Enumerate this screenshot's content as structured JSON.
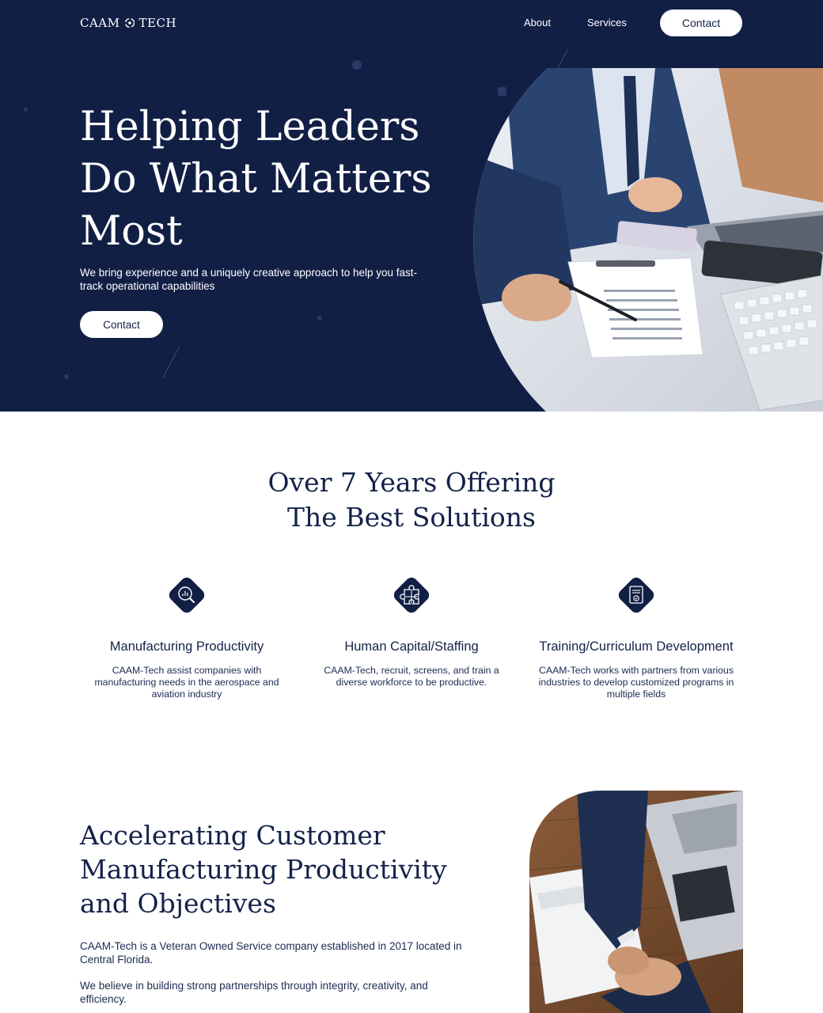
{
  "nav": {
    "logo_left": "CAAM",
    "logo_right": "TECH",
    "about": "About",
    "services": "Services",
    "contact": "Contact"
  },
  "hero": {
    "title": "Helping Leaders Do What Matters Most",
    "subtitle": "We bring experience and a uniquely creative approach to help you fast-track operational capabilities",
    "button": "Contact"
  },
  "solutions": {
    "title_line1": "Over 7 Years Offering",
    "title_line2": "The Best Solutions",
    "cards": [
      {
        "icon": "magnifier-chart-icon",
        "title": "Manufacturing Productivity",
        "text": "CAAM-Tech assist companies with manufacturing needs in the aerospace and aviation industry"
      },
      {
        "icon": "puzzle-icon",
        "title": "Human Capital/Staffing",
        "text": "CAAM-Tech, recruit, screens, and train a diverse workforce to be productive."
      },
      {
        "icon": "document-badge-icon",
        "title": "Training/Curriculum Development",
        "text": "CAAM-Tech works with partners from various industries to develop customized programs in multiple fields"
      }
    ]
  },
  "about": {
    "title": "Accelerating Customer Manufacturing Productivity and Objectives",
    "p1": "CAAM-Tech is a Veteran Owned Service company established in 2017 located in Central Florida.",
    "p2": "We believe in building strong partnerships through integrity, creativity, and efficiency."
  },
  "colors": {
    "navy": "#121f45",
    "text_navy": "#142249",
    "white": "#ffffff"
  }
}
